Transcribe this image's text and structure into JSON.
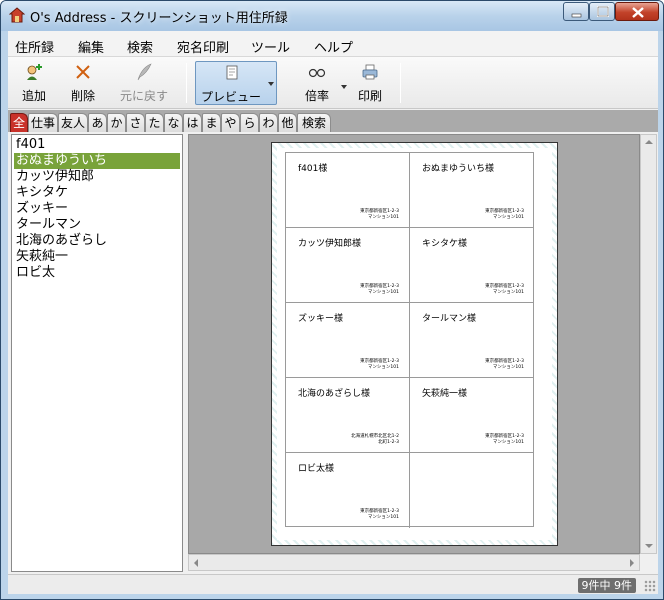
{
  "window": {
    "title": "O's Address - スクリーンショット用住所録"
  },
  "menu": [
    "住所録",
    "編集",
    "検索",
    "宛名印刷",
    "ツール",
    "ヘルプ"
  ],
  "toolbar": {
    "add": "追加",
    "delete": "削除",
    "undo": "元に戻す",
    "preview": "プレビュー",
    "zoom": "倍率",
    "print": "印刷"
  },
  "tabs": [
    "全",
    "仕事",
    "友人",
    "あ",
    "か",
    "さ",
    "た",
    "な",
    "は",
    "ま",
    "や",
    "ら",
    "わ",
    "他",
    "検索"
  ],
  "list": {
    "items": [
      "f401",
      "おぬまゆういち",
      "カッツ伊知郎",
      "キシタケ",
      "ズッキー",
      "タールマン",
      "北海のあざらし",
      "矢萩純一",
      "ロビ太"
    ],
    "selected_index": 1
  },
  "labels": [
    {
      "name": "f401様",
      "address_line1": "東京都新宿区1-2-3",
      "address_line2": "マンション101"
    },
    {
      "name": "おぬまゆういち様",
      "address_line1": "東京都新宿区1-2-3",
      "address_line2": "マンション101"
    },
    {
      "name": "カッツ伊知郎様",
      "address_line1": "東京都新宿区1-2-3",
      "address_line2": "マンション101"
    },
    {
      "name": "キシタケ様",
      "address_line1": "東京都新宿区1-2-3",
      "address_line2": "マンション101"
    },
    {
      "name": "ズッキー様",
      "address_line1": "東京都新宿区1-2-3",
      "address_line2": "マンション101"
    },
    {
      "name": "タールマン様",
      "address_line1": "東京都新宿区1-2-3",
      "address_line2": "マンション101"
    },
    {
      "name": "北海のあざらし様",
      "address_line1": "北海道札幌市北区北1-2",
      "address_line2": "北町1-2-3"
    },
    {
      "name": "矢萩純一様",
      "address_line1": "東京都新宿区1-2-3",
      "address_line2": "マンション101"
    },
    {
      "name": "ロビ太様",
      "address_line1": "東京都新宿区1-2-3",
      "address_line2": "マンション101"
    }
  ],
  "status": {
    "count": "9件中 9件"
  },
  "colors": {
    "tab_active": "#c9322a",
    "list_selected": "#79a33a",
    "preview_bg": "#a8a8a8"
  }
}
